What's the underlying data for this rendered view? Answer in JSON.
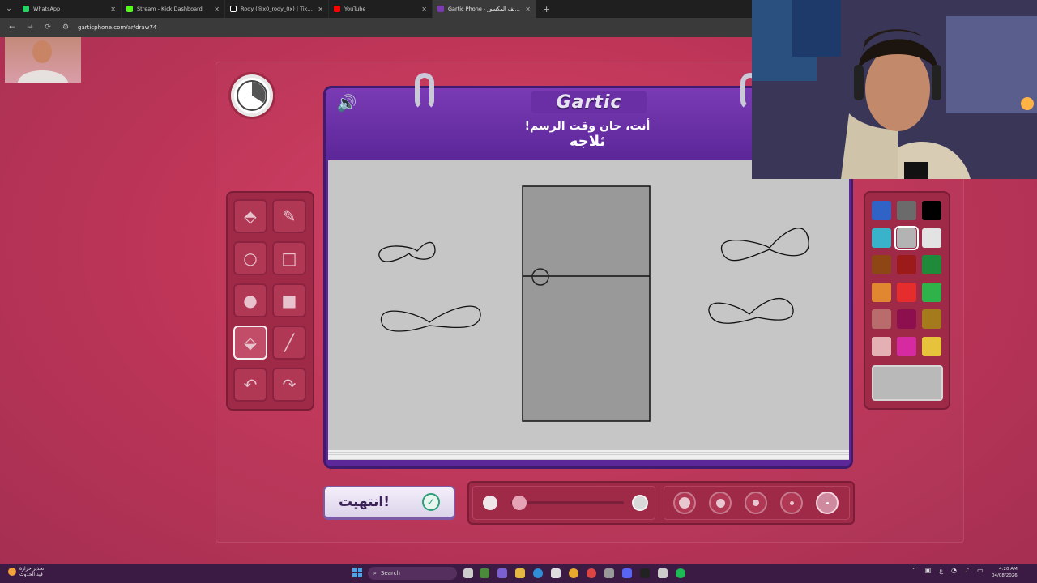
{
  "browser": {
    "tabs": [
      {
        "title": "WhatsApp",
        "favicon_color": "#25d366"
      },
      {
        "title": "Stream - Kick Dashboard",
        "favicon_color": "#53fc18"
      },
      {
        "title": "Rody (@x0_rody_0x) | TikTok",
        "favicon_color": "#111111"
      },
      {
        "title": "YouTube",
        "favicon_color": "#ff0000"
      },
      {
        "title": "Gartic Phone - لعبة الهاتف المكسور",
        "favicon_color": "#7a3bb4"
      }
    ],
    "new_tab_symbol": "+",
    "close_symbol": "✕",
    "url": "garticphone.com/ar/draw74"
  },
  "game": {
    "logo": "Gartic",
    "prompt_line": "أنت، حان وقت الرسم!",
    "word": "ثلاجه",
    "sound_icon": "🔊",
    "done_label": "انتهيت!",
    "done_icon": "✓",
    "tools": [
      {
        "name": "eraser",
        "glyph": "⬘"
      },
      {
        "name": "pencil",
        "glyph": "✎"
      },
      {
        "name": "ellipse-outline",
        "glyph": "○"
      },
      {
        "name": "rectangle-outline",
        "glyph": "□"
      },
      {
        "name": "ellipse-filled",
        "glyph": "●"
      },
      {
        "name": "rectangle-filled",
        "glyph": "■"
      },
      {
        "name": "fill-bucket",
        "glyph": "⬙"
      },
      {
        "name": "line",
        "glyph": "╱"
      },
      {
        "name": "undo",
        "glyph": "↶"
      },
      {
        "name": "redo",
        "glyph": "↷"
      }
    ],
    "active_tool": "fill-bucket",
    "palette": [
      "#2f63c6",
      "#6b6b6b",
      "#000000",
      "#39b3c9",
      "#b3b3b3",
      "#e3e3e3",
      "#8e4615",
      "#9c1a1a",
      "#1f8a3a",
      "#e0872f",
      "#e52d2d",
      "#2fb24a",
      "#b86c6c",
      "#8e0f4e",
      "#a57a1c",
      "#e5b0b4",
      "#d62aa0",
      "#e6c33b"
    ],
    "selected_color": "#b3b3b3",
    "current_fill": "#b9b9b9",
    "opacity_level": 0.95,
    "active_brush_size": 5
  },
  "taskbar": {
    "weather_line1": "تحذير حرارة",
    "weather_line2": "قيد الحدوث",
    "search_placeholder": "Search",
    "clock_time": "4:20 AM",
    "clock_date": "04/08/2026"
  }
}
